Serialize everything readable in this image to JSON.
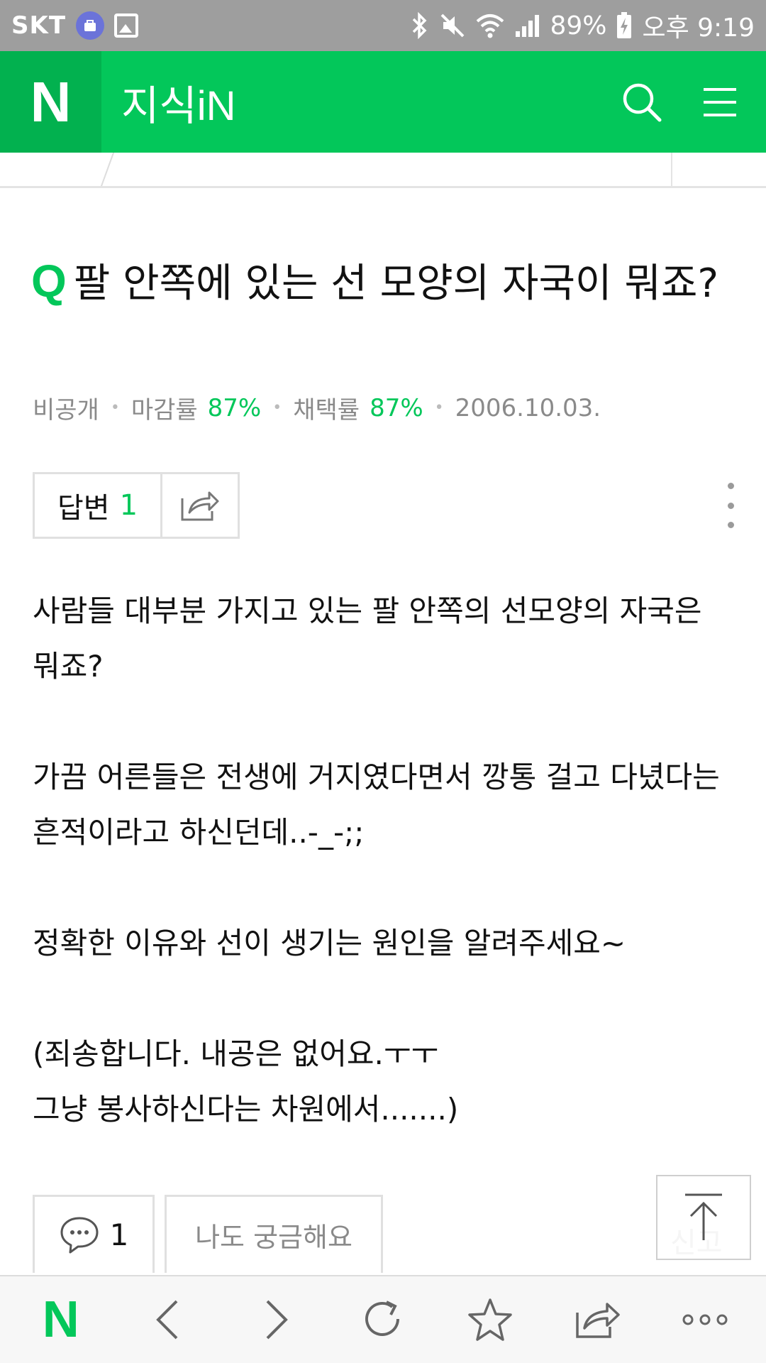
{
  "status_bar": {
    "carrier": "SKT",
    "battery": "89%",
    "time": "오후 9:19"
  },
  "app_bar": {
    "logo": "N",
    "title": "지식iN",
    "search_icon": "search-icon",
    "menu_icon": "hamburger-menu-icon"
  },
  "question": {
    "q_mark": "Q",
    "title": "팔 안쪽에 있는 선 모양의 자국이 뭐죠?",
    "meta": {
      "author": "비공개",
      "close_rate_label": "마감률",
      "close_rate": "87%",
      "adopt_rate_label": "채택률",
      "adopt_rate": "87%",
      "date": "2006.10.03."
    },
    "answer_label": "답변",
    "answer_count": "1",
    "body": [
      "사람들 대부분 가지고 있는 팔 안쪽의 선모양의 자국은 뭐죠?",
      "가끔 어른들은 전생에 거지였다면서 깡통 걸고 다녔다는 흔적이라고 하신던데..-_-;;",
      "정확한 이유와 선이 생기는 원인을 알려주세요~",
      "(죄송합니다. 내공은 없어요.ㅜㅜ",
      "그냥 봉사하신다는 차원에서.......)"
    ],
    "comment_count": "1",
    "curious_label": "나도 궁금해요",
    "report_label": "신고"
  },
  "colors": {
    "brand_green": "#03c75a",
    "brand_green_dark": "#02b14f",
    "status_bar": "#9e9e9e"
  }
}
